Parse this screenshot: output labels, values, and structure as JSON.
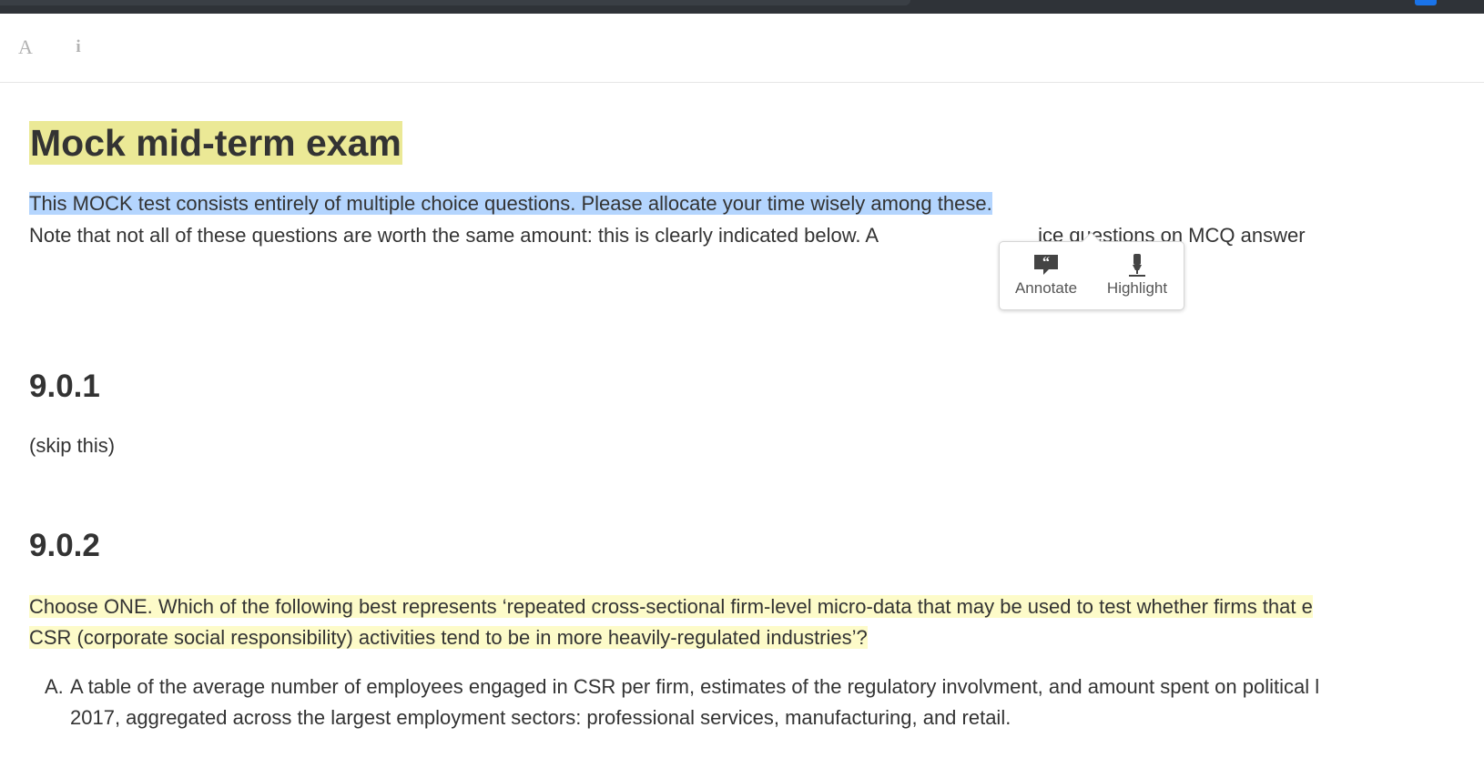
{
  "toolbar": {
    "font_icon": "A",
    "info_icon": "i"
  },
  "document": {
    "title": "Mock mid-term exam",
    "intro_selected": "This MOCK test consists entirely of multiple choice questions. Please allocate your time wisely among these.",
    "intro_line2_before": "Note that not all of these questions are worth the same amount: this is clearly indicated below. A",
    "intro_line2_after": "ice questions on MCQ answer",
    "sections": [
      {
        "heading": "9.0.1",
        "body": "(skip this)"
      },
      {
        "heading": "9.0.2",
        "question_line1": "Choose ONE. Which of the following best represents ‘repeated cross-sectional firm-level micro-data that may be used to test whether firms that e",
        "question_line2": "CSR (corporate social responsibility) activities tend to be in more heavily-regulated industries’?",
        "options": [
          {
            "marker": "A.",
            "line1": "A table of the average number of employees engaged in CSR per firm, estimates of the regulatory involvment, and amount spent on political l",
            "line2": "2017, aggregated across the largest employment sectors: professional services, manufacturing, and retail."
          }
        ]
      }
    ]
  },
  "popover": {
    "annotate_label": "Annotate",
    "highlight_label": "Highlight"
  },
  "colors": {
    "title_highlight": "#ebe996",
    "selection": "#b4d5fe",
    "question_highlight": "#fdfbc9",
    "text": "#333333",
    "topbar": "#2f3338"
  }
}
